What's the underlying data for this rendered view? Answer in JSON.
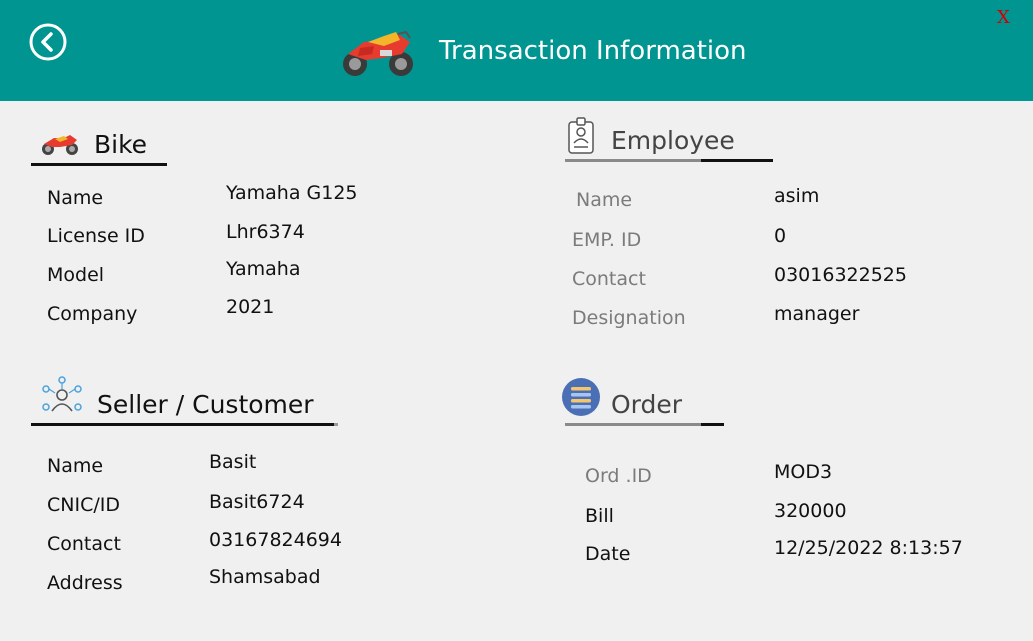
{
  "header": {
    "title": "Transaction Information",
    "close_label": "X",
    "back_icon": "back-circle-icon",
    "logo_icon": "motorbike-icon"
  },
  "bike": {
    "title": "Bike",
    "rows": [
      {
        "label": "Name",
        "value": "Yamaha G125"
      },
      {
        "label": "License ID",
        "value": "Lhr6374"
      },
      {
        "label": "Model",
        "value": "Yamaha"
      },
      {
        "label": "Company",
        "value": "2021"
      }
    ]
  },
  "employee": {
    "title": "Employee",
    "rows": [
      {
        "label": "Name",
        "value": "asim"
      },
      {
        "label": "EMP. ID",
        "value": "0"
      },
      {
        "label": "Contact",
        "value": "03016322525"
      },
      {
        "label": "Designation",
        "value": "manager"
      }
    ]
  },
  "seller": {
    "title": "Seller / Customer",
    "rows": [
      {
        "label": "Name",
        "value": "Basit"
      },
      {
        "label": "CNIC/ID",
        "value": "Basit6724"
      },
      {
        "label": "Contact",
        "value": "03167824694"
      },
      {
        "label": "Address",
        "value": "Shamsabad"
      }
    ]
  },
  "order": {
    "title": "Order",
    "rows": [
      {
        "label": "Ord .ID",
        "value": "MOD3"
      },
      {
        "label": "Bill",
        "value": "320000"
      },
      {
        "label": "Date",
        "value": "12/25/2022 8:13:57"
      }
    ]
  },
  "colors": {
    "header_bg": "#009591",
    "page_bg": "#f0f0f0",
    "close": "#d40000",
    "muted_label": "#7b7b7b"
  }
}
